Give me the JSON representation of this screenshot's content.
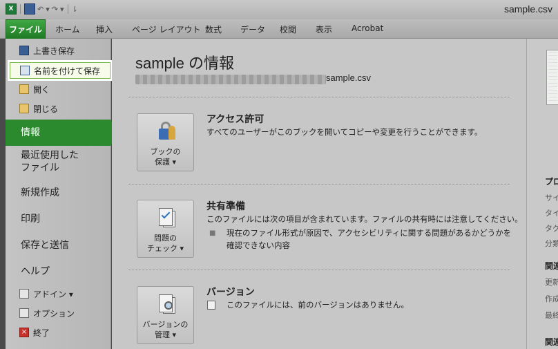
{
  "window": {
    "title": "sample.csv",
    "qat": {
      "excel_icon": "X"
    }
  },
  "ribbon": {
    "file_tab": "ファイル",
    "tabs": [
      "ホーム",
      "挿入",
      "ページ レイアウト",
      "数式",
      "データ",
      "校閲",
      "表示",
      "Acrobat"
    ]
  },
  "nav": {
    "save": "上書き保存",
    "save_as": "名前を付けて保存",
    "open": "開く",
    "close": "閉じる",
    "info": "情報",
    "recent_line1": "最近使用した",
    "recent_line2": "ファイル",
    "new": "新規作成",
    "print": "印刷",
    "save_send": "保存と送信",
    "help": "ヘルプ",
    "addins": "アドイン ▾",
    "options": "オプション",
    "exit": "終了"
  },
  "main": {
    "title": "sample の情報",
    "filename": "sample.csv",
    "protect": {
      "button_line1": "ブックの",
      "button_line2": "保護 ▾",
      "heading": "アクセス許可",
      "text": "すべてのユーザーがこのブックを開いてコピーや変更を行うことができます。"
    },
    "check": {
      "button_line1": "問題の",
      "button_line2": "チェック ▾",
      "heading": "共有準備",
      "text": "このファイルには次の項目が含まれています。ファイルの共有時には注意してください。",
      "bullet": "現在のファイル形式が原因で、アクセシビリティに関する問題があるかどうかを確認できない内容"
    },
    "versions": {
      "button_line1": "バージョンの",
      "button_line2": "管理 ▾",
      "heading": "バージョン",
      "text": "このファイルには、前のバージョンはありません。"
    }
  },
  "right_panel": {
    "labels": [
      "プロ",
      "サイ",
      "タイ",
      "タグ",
      "分類",
      "関連",
      "更新",
      "作成",
      "最終",
      "関連"
    ]
  }
}
